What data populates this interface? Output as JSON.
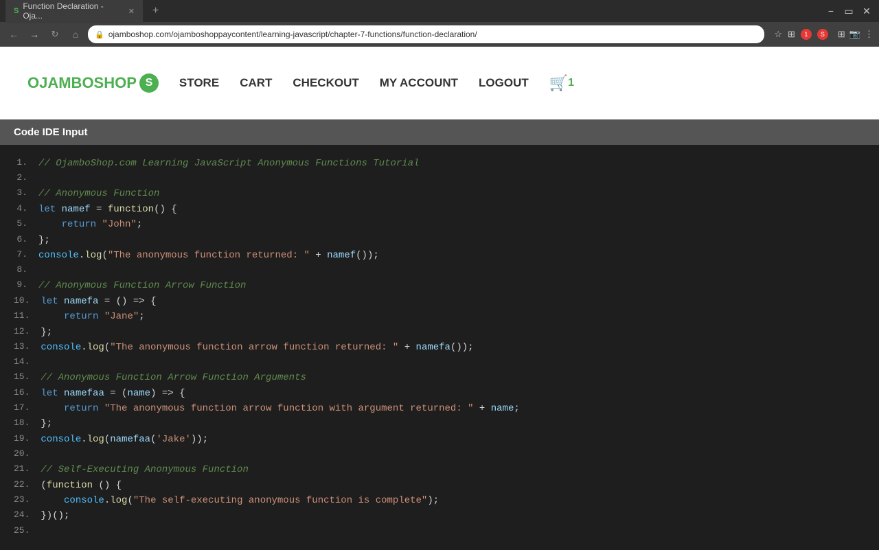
{
  "browser": {
    "tab_title": "Function Declaration - Oja...",
    "tab_icon": "S",
    "url": "ojamboshop.com/ojamboshoppaycontent/learning-javascript/chapter-7-functions/function-declaration/",
    "new_tab_label": "+",
    "nav_back": "←",
    "nav_forward": "→",
    "nav_reload": "↻"
  },
  "nav": {
    "logo_text": "OJAMBOSHOP",
    "logo_letter": "S",
    "links": [
      {
        "label": "STORE",
        "active": false
      },
      {
        "label": "CART",
        "active": false
      },
      {
        "label": "CHECKOUT",
        "active": false
      },
      {
        "label": "MY ACCOUNT",
        "active": false
      },
      {
        "label": "LOGOUT",
        "active": false
      }
    ],
    "cart_count": "1"
  },
  "code_section": {
    "header": "Code IDE Input",
    "lines": [
      {
        "num": "1.",
        "content": "// OjamboShop.com Learning JavaScript Anonymous Functions Tutorial",
        "type": "comment"
      },
      {
        "num": "2.",
        "content": "",
        "type": "plain"
      },
      {
        "num": "3.",
        "content": "// Anonymous Function",
        "type": "comment"
      },
      {
        "num": "4.",
        "content": "let namef = function() {",
        "type": "code"
      },
      {
        "num": "5.",
        "content": "    return \"John\";",
        "type": "code"
      },
      {
        "num": "6.",
        "content": "};",
        "type": "code"
      },
      {
        "num": "7.",
        "content": "console.log(\"The anonymous function returned: \" + namef());",
        "type": "code"
      },
      {
        "num": "8.",
        "content": "",
        "type": "plain"
      },
      {
        "num": "9.",
        "content": "// Anonymous Function Arrow Function",
        "type": "comment"
      },
      {
        "num": "10.",
        "content": "let namefa = () => {",
        "type": "code"
      },
      {
        "num": "11.",
        "content": "    return \"Jane\";",
        "type": "code"
      },
      {
        "num": "12.",
        "content": "};",
        "type": "code"
      },
      {
        "num": "13.",
        "content": "console.log(\"The anonymous function arrow function returned: \" + namefa());",
        "type": "code"
      },
      {
        "num": "14.",
        "content": "",
        "type": "plain"
      },
      {
        "num": "15.",
        "content": "// Anonymous Function Arrow Function Arguments",
        "type": "comment"
      },
      {
        "num": "16.",
        "content": "let namefaa = (name) => {",
        "type": "code"
      },
      {
        "num": "17.",
        "content": "    return \"The anonymous function arrow function with argument returned: \" + name;",
        "type": "code"
      },
      {
        "num": "18.",
        "content": "};",
        "type": "code"
      },
      {
        "num": "19.",
        "content": "console.log(namefaa('Jake'));",
        "type": "code"
      },
      {
        "num": "20.",
        "content": "",
        "type": "plain"
      },
      {
        "num": "21.",
        "content": "// Self-Executing Anonymous Function",
        "type": "comment"
      },
      {
        "num": "22.",
        "content": "(function () {",
        "type": "code"
      },
      {
        "num": "23.",
        "content": "    console.log(\"The self-executing anonymous function is complete\");",
        "type": "code"
      },
      {
        "num": "24.",
        "content": "})();",
        "type": "code"
      },
      {
        "num": "25.",
        "content": "",
        "type": "plain"
      }
    ]
  }
}
